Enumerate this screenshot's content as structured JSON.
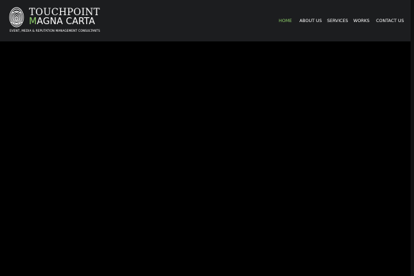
{
  "header": {
    "logo": {
      "line1": "TOUCHPOINT",
      "line2_initial": "M",
      "line2_rest": "AGNA CARTA",
      "tagline": "EVENT, MEDIA & REPUTATION MANAGEMENT CONSULTANTS"
    },
    "nav": {
      "items": [
        {
          "label": "HOME",
          "active": true
        },
        {
          "label": "ABOUT US",
          "active": false
        },
        {
          "label": "SERVICES",
          "active": false
        },
        {
          "label": "WORKS",
          "active": false
        },
        {
          "label": "CONTACT US",
          "active": false
        }
      ]
    }
  },
  "colors": {
    "header_bg": "#1c1d1f",
    "page_bg": "#000000",
    "accent": "#8fcf6b",
    "text": "#ffffff"
  }
}
